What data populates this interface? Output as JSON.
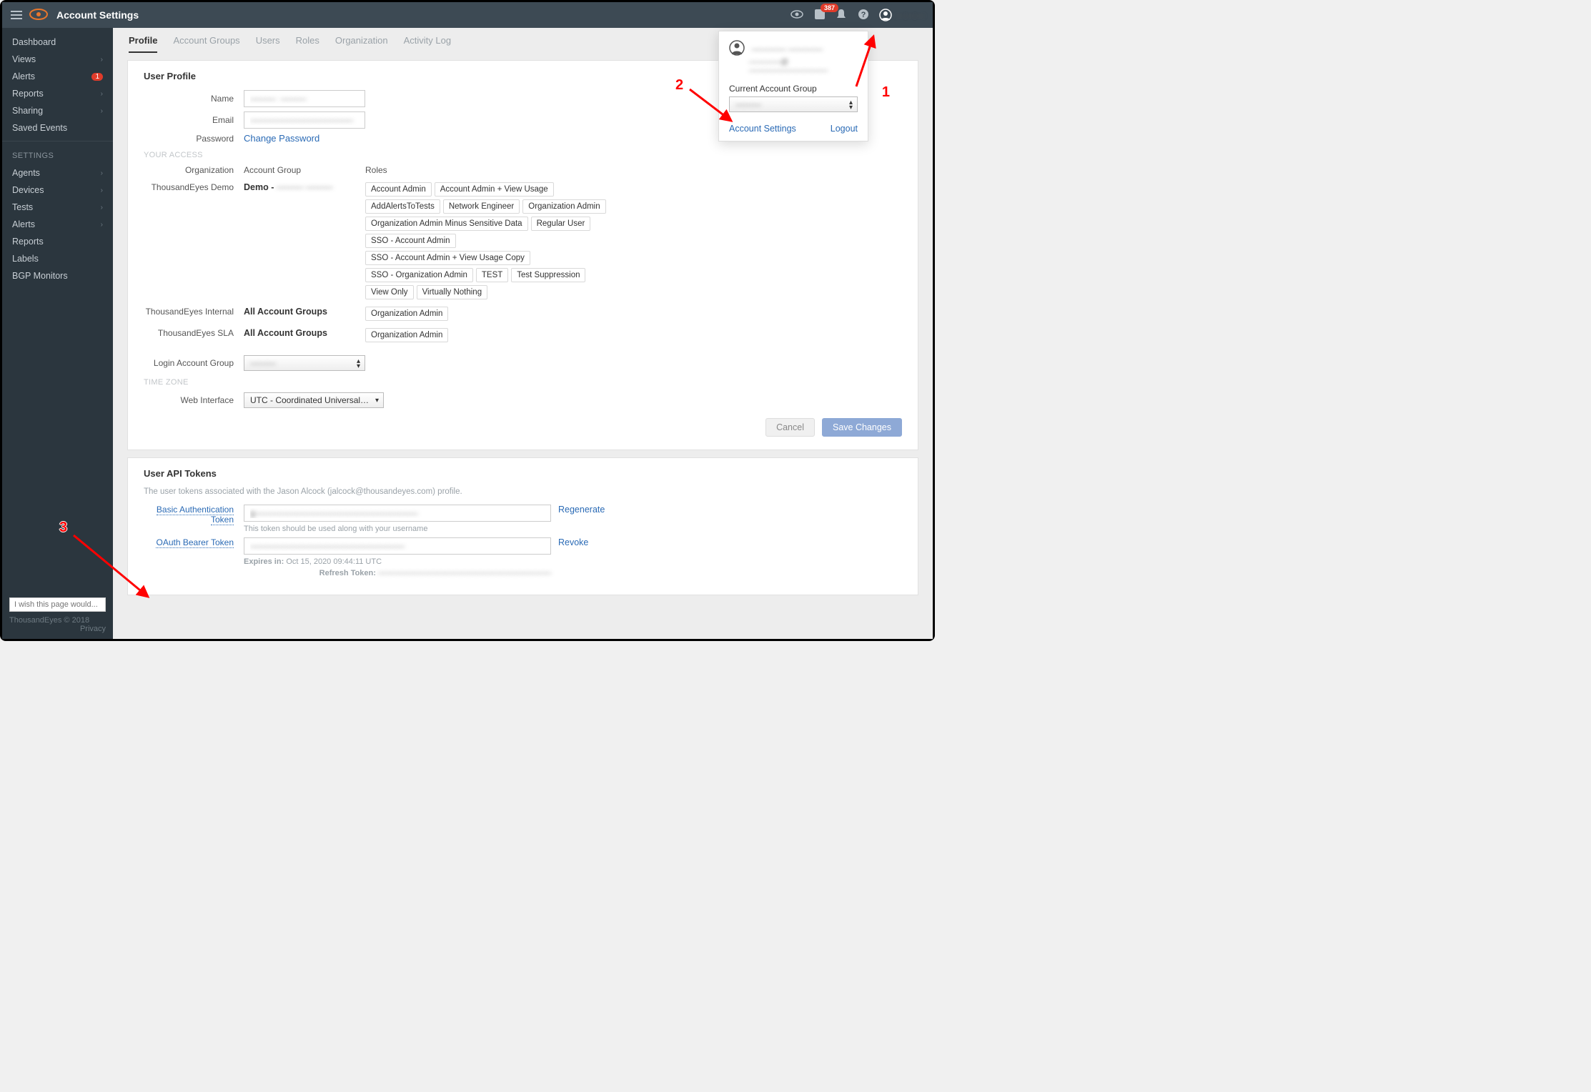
{
  "topbar": {
    "title": "Account Settings",
    "badge_count": "387",
    "username": "———"
  },
  "sidebar": {
    "nav": [
      {
        "label": "Dashboard",
        "chev": false
      },
      {
        "label": "Views",
        "chev": true
      },
      {
        "label": "Alerts",
        "chev": false,
        "badge": "1"
      },
      {
        "label": "Reports",
        "chev": true
      },
      {
        "label": "Sharing",
        "chev": true
      },
      {
        "label": "Saved Events",
        "chev": false
      }
    ],
    "settings_header": "SETTINGS",
    "settings": [
      {
        "label": "Agents",
        "chev": true
      },
      {
        "label": "Devices",
        "chev": true
      },
      {
        "label": "Tests",
        "chev": true
      },
      {
        "label": "Alerts",
        "chev": true
      },
      {
        "label": "Reports",
        "chev": false
      },
      {
        "label": "Labels",
        "chev": false
      },
      {
        "label": "BGP Monitors",
        "chev": false
      }
    ],
    "wish_placeholder": "I wish this page would...",
    "copyright": "ThousandEyes © 2018",
    "privacy": "Privacy"
  },
  "tabs": [
    "Profile",
    "Account Groups",
    "Users",
    "Roles",
    "Organization",
    "Activity Log"
  ],
  "profile": {
    "heading": "User Profile",
    "name_label": "Name",
    "name_value": "———  ———",
    "email_label": "Email",
    "email_value": "————————————",
    "password_label": "Password",
    "change_password": "Change Password",
    "access_header": "YOUR ACCESS",
    "col_org": "Organization",
    "col_ag": "Account Group",
    "col_roles": "Roles",
    "orgs": [
      {
        "name": "ThousandEyes Demo",
        "group_prefix": "Demo - ",
        "group_blur": "——— ———",
        "roles": [
          "Account Admin",
          "Account Admin + View Usage",
          "AddAlertsToTests",
          "Network Engineer",
          "Organization Admin",
          "Organization Admin Minus Sensitive Data",
          "Regular User",
          "SSO - Account Admin",
          "SSO - Account Admin + View Usage Copy",
          "SSO - Organization Admin",
          "TEST",
          "Test Suppression",
          "View Only",
          "Virtually Nothing"
        ]
      },
      {
        "name": "ThousandEyes Internal",
        "group": "All Account Groups",
        "roles": [
          "Organization Admin"
        ]
      },
      {
        "name": "ThousandEyes SLA",
        "group": "All Account Groups",
        "roles": [
          "Organization Admin"
        ]
      }
    ],
    "login_ag_label": "Login Account Group",
    "login_ag_value": "———",
    "tz_header": "TIME ZONE",
    "web_iface_label": "Web Interface",
    "web_iface_value": "UTC - Coordinated Universal…",
    "cancel": "Cancel",
    "save": "Save Changes"
  },
  "tokens": {
    "heading": "User API Tokens",
    "subtitle": "The user tokens associated with the Jason Alcock (jalcock@thousandeyes.com) profile.",
    "basic_label": "Basic Authentication Token",
    "basic_value": "g———————————————————",
    "basic_hint": "This token should be used along with your username",
    "regenerate": "Regenerate",
    "oauth_label": "OAuth Bearer Token",
    "oauth_value": "——————————————————",
    "revoke": "Revoke",
    "expires_label": "Expires in:",
    "expires_value": "Oct 15, 2020 09:44:11 UTC",
    "refresh_label": "Refresh Token:",
    "refresh_value": "——————————————————————"
  },
  "dropdown": {
    "username": "———— ————",
    "email": "————@——————————",
    "cag_label": "Current Account Group",
    "cag_value": "———",
    "account_settings": "Account Settings",
    "logout": "Logout"
  },
  "annotations": {
    "1": "1",
    "2": "2",
    "3": "3"
  }
}
